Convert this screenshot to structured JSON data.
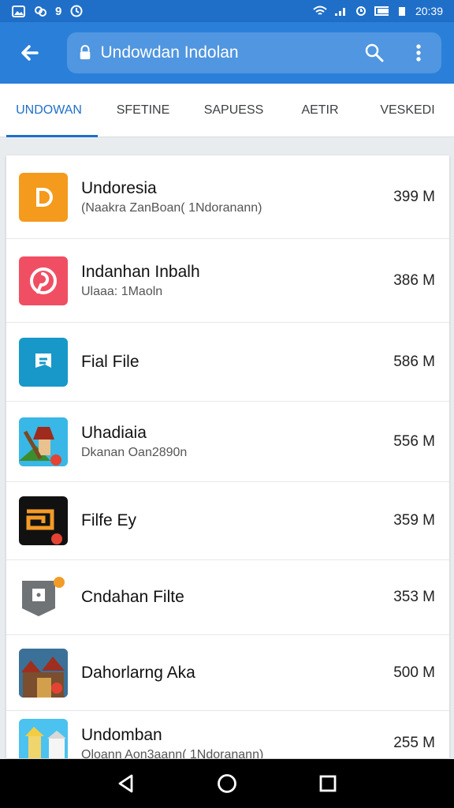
{
  "status_bar": {
    "left_icons": [
      "image-icon",
      "link-icon",
      "9",
      "clock-icon"
    ],
    "time": "20:39"
  },
  "toolbar": {
    "title": "Undowdan Indolan",
    "back_icon": "back-arrow-icon",
    "search_icon": "search-icon",
    "more_icon": "more-vert-icon",
    "colors": {
      "primary": "#2a7fd9",
      "status": "#1f6fc9"
    }
  },
  "tabs": [
    {
      "label": "UNDOWAN",
      "active": true
    },
    {
      "label": "SFETINE",
      "active": false
    },
    {
      "label": "SAPUESS",
      "active": false
    },
    {
      "label": "AETIR",
      "active": false
    },
    {
      "label": "VESKEDI",
      "active": false
    }
  ],
  "files": [
    {
      "title": "Undoresia",
      "subtitle": "(Naakra ZanBoan( 1Ndoranann)",
      "size": "399 M",
      "icon": "orange-d-icon"
    },
    {
      "title": "Indanhan Inbalh",
      "subtitle": "Ulaaa: 1Maoln",
      "size": "386 M",
      "icon": "pinterest-icon"
    },
    {
      "title": "Fial File",
      "subtitle": "",
      "size": "586 M",
      "icon": "blue-flag-icon"
    },
    {
      "title": "Uhadiaia",
      "subtitle": "Dkanan Oan2890n",
      "size": "556 M",
      "icon": "temple-image-icon"
    },
    {
      "title": "Filfe Ey",
      "subtitle": "",
      "size": "359 M",
      "icon": "orange-box-icon"
    },
    {
      "title": "Cndahan Filte",
      "subtitle": "",
      "size": "353 M",
      "icon": "grey-file-icon"
    },
    {
      "title": "Dahorlarng Aka",
      "subtitle": "",
      "size": "500 M",
      "icon": "village-image-icon"
    },
    {
      "title": "Undomban",
      "subtitle": "Oloann Aon3aann( 1Ndoranann)",
      "size": "255 M",
      "icon": "palace-image-icon"
    }
  ],
  "navigation": {
    "back": "back-triangle-icon",
    "home": "home-circle-icon",
    "recents": "recents-square-icon"
  }
}
